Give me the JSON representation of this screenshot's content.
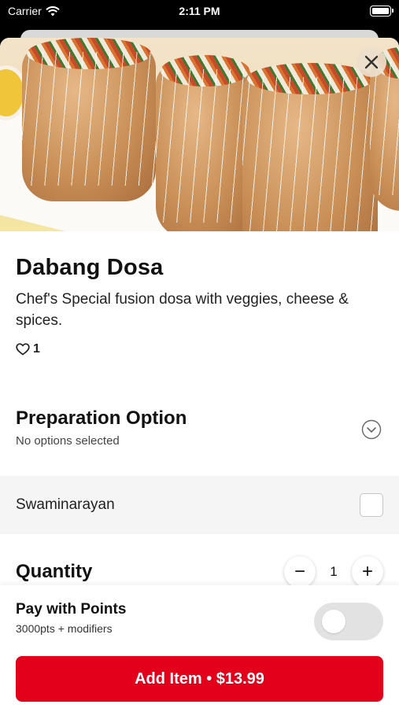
{
  "status_bar": {
    "carrier": "Carrier",
    "time": "2:11 PM"
  },
  "item": {
    "title": "Dabang Dosa",
    "description": "Chef's Special fusion dosa with veggies, cheese & spices.",
    "likes": "1"
  },
  "preparation": {
    "heading": "Preparation Option",
    "subtext": "No options selected",
    "options": [
      {
        "label": "Swaminarayan",
        "checked": false
      }
    ]
  },
  "quantity": {
    "heading": "Quantity",
    "value": "1",
    "decrement": "−",
    "increment": "+"
  },
  "points": {
    "heading": "Pay with Points",
    "subtext": "3000pts + modifiers",
    "enabled": false
  },
  "add_button": {
    "label": "Add Item • $13.99"
  },
  "colors": {
    "accent": "#e2001a",
    "toggle_off": "#e2e2e2",
    "option_bg": "#f5f5f5"
  },
  "icons": [
    "wifi-icon",
    "battery-icon",
    "close-icon",
    "heart-icon",
    "chevron-down-icon",
    "checkbox-icon",
    "minus-icon",
    "plus-icon"
  ]
}
